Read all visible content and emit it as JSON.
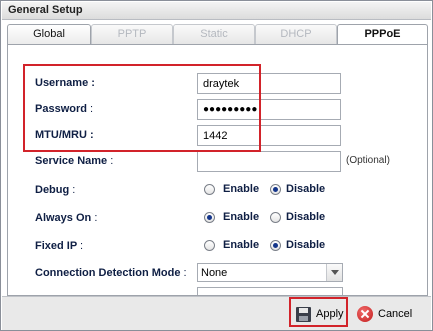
{
  "window": {
    "title": "General Setup"
  },
  "tabs": [
    {
      "label": "Global",
      "state": "active"
    },
    {
      "label": "PPTP",
      "state": "disabled"
    },
    {
      "label": "Static",
      "state": "disabled"
    },
    {
      "label": "DHCP",
      "state": "disabled"
    },
    {
      "label": "PPPoE",
      "state": "selected"
    }
  ],
  "form": {
    "username": {
      "label": "Username",
      "colon": ":",
      "value": "draytek"
    },
    "password": {
      "label": "Password",
      "colon": ":",
      "value": "●●●●●●●●●"
    },
    "mtu": {
      "label": "MTU/MRU",
      "colon": ":",
      "value": "1442"
    },
    "service_name": {
      "label": "Service Name",
      "colon": ":",
      "value": "",
      "hint": "(Optional)"
    },
    "debug": {
      "label": "Debug",
      "colon": ":",
      "enable": "Enable",
      "disable": "Disable",
      "selected": "Disable"
    },
    "always_on": {
      "label": "Always On",
      "colon": ":",
      "enable": "Enable",
      "disable": "Disable",
      "selected": "Enable"
    },
    "fixed_ip": {
      "label": "Fixed IP",
      "colon": ":",
      "enable": "Enable",
      "disable": "Disable",
      "selected": "Disable"
    },
    "detection": {
      "label": "Connection Detection Mode",
      "colon": ":",
      "value": "None"
    }
  },
  "footer": {
    "apply_label": "Apply",
    "cancel_label": "Cancel"
  },
  "colors": {
    "highlight": "#d2232a",
    "label": "#0f1f44",
    "radio_dot": "#14358a"
  }
}
